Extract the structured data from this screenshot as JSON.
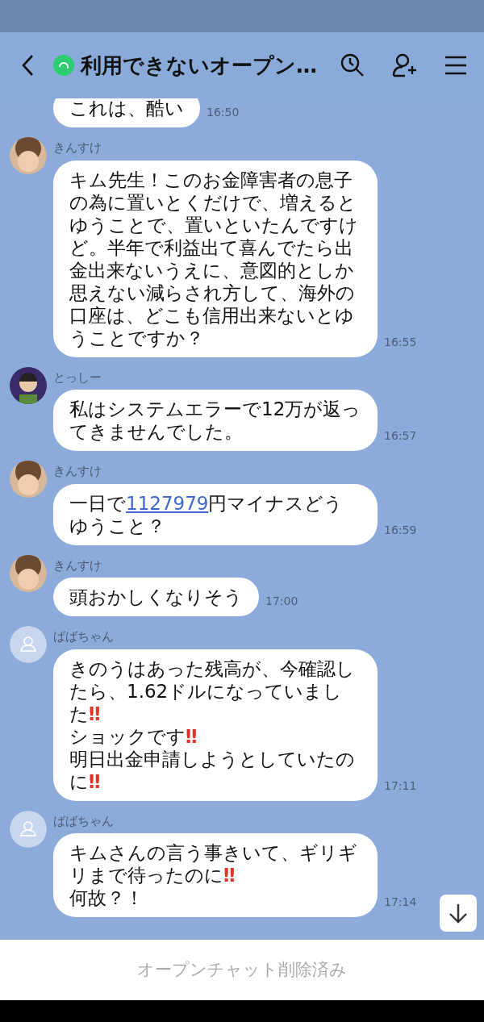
{
  "header": {
    "title": "利用できないオープン…"
  },
  "messages": [
    {
      "kind": "continuation",
      "parts": [
        {
          "kind": "plain",
          "text": "これは、酷い"
        }
      ],
      "time": "16:50"
    },
    {
      "kind": "message",
      "sender": "きんすけ",
      "avatar": {
        "kind": "photo"
      },
      "parts": [
        {
          "kind": "plain",
          "text": "キム先生！このお金障害者の息子の為に置いとくだけで、増えるとゆうことで、置いといたんですけど。半年で利益出て喜んでたら出金出来ないうえに、意図的としか思えない減らされ方して、海外の口座は、どこも信用出来ないとゆうことですか？"
        }
      ],
      "time": "16:55"
    },
    {
      "kind": "message",
      "sender": "とっしー",
      "avatar": {
        "kind": "character"
      },
      "parts": [
        {
          "kind": "plain",
          "text": "私はシステムエラーで12万が返ってきませんでした。"
        }
      ],
      "time": "16:57"
    },
    {
      "kind": "message",
      "sender": "きんすけ",
      "avatar": {
        "kind": "photo"
      },
      "parts": [
        {
          "kind": "plain",
          "text": "一日で"
        },
        {
          "kind": "link",
          "text": "1127979"
        },
        {
          "kind": "plain",
          "text": "円マイナスどうゆうこと？"
        }
      ],
      "time": "16:59"
    },
    {
      "kind": "message",
      "sender": "きんすけ",
      "avatar": {
        "kind": "photo"
      },
      "parts": [
        {
          "kind": "plain",
          "text": "頭おかしくなりそう"
        }
      ],
      "time": "17:00"
    },
    {
      "kind": "message",
      "sender": "ばばちゃん",
      "avatar": {
        "kind": "default"
      },
      "parts": [
        {
          "kind": "plain",
          "text": "きのうはあった残高が、今確認したら、1.62ドルになっていました"
        },
        {
          "kind": "emoji",
          "text": "‼"
        },
        {
          "kind": "break"
        },
        {
          "kind": "plain",
          "text": "ショックです"
        },
        {
          "kind": "emoji",
          "text": "‼"
        },
        {
          "kind": "break"
        },
        {
          "kind": "plain",
          "text": "明日出金申請しようとしていたのに"
        },
        {
          "kind": "emoji",
          "text": "‼"
        }
      ],
      "time": "17:11"
    },
    {
      "kind": "message",
      "sender": "ばばちゃん",
      "avatar": {
        "kind": "default"
      },
      "parts": [
        {
          "kind": "plain",
          "text": "キムさんの言う事きいて、ギリギリまで待ったのに"
        },
        {
          "kind": "emoji",
          "text": "‼"
        },
        {
          "kind": "break"
        },
        {
          "kind": "plain",
          "text": "何故？！"
        }
      ],
      "time": "17:14"
    }
  ],
  "footer": {
    "notice": "オープンチャット削除済み"
  }
}
